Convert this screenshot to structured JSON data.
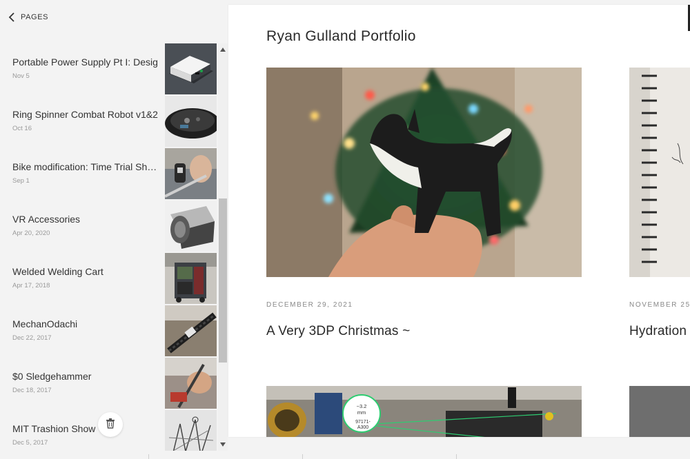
{
  "sidebar": {
    "back_label": "PAGES",
    "pages": [
      {
        "title": "Portable Power Supply Pt I: Desig",
        "date": "Nov 5"
      },
      {
        "title": "Ring Spinner Combat Robot v1&2",
        "date": "Oct 16"
      },
      {
        "title": "Bike modification: Time Trial Shifters",
        "date": "Sep 1"
      },
      {
        "title": "VR Accessories",
        "date": "Apr 20, 2020"
      },
      {
        "title": "Welded Welding Cart",
        "date": "Apr 17, 2018"
      },
      {
        "title": "MechanOdachi",
        "date": "Dec 22, 2017"
      },
      {
        "title": "$0 Sledgehammer",
        "date": "Dec 18, 2017"
      },
      {
        "title": "MIT Trashion Show",
        "date": "Dec 5, 2017"
      }
    ]
  },
  "preview": {
    "site_title": "Ryan Gulland Portfolio",
    "posts": [
      {
        "date": "DECEMBER 29, 2021",
        "title": "A Very 3DP Christmas ~"
      },
      {
        "date": "NOVEMBER 25,",
        "title": "Hydration"
      }
    ],
    "annotation": {
      "line1": "~3.2",
      "line2": "mm",
      "line3": "97171-",
      "line4": "A300"
    }
  },
  "icons": {
    "back": "chevron-left-icon",
    "trash": "trash-icon",
    "scroll_up": "scroll-up-arrow-icon",
    "scroll_down": "scroll-down-arrow-icon"
  },
  "colors": {
    "sidebar_bg": "#f3f3f3",
    "preview_bg": "#ffffff",
    "date_grey": "#999999",
    "title_dark": "#2a2a2a"
  }
}
